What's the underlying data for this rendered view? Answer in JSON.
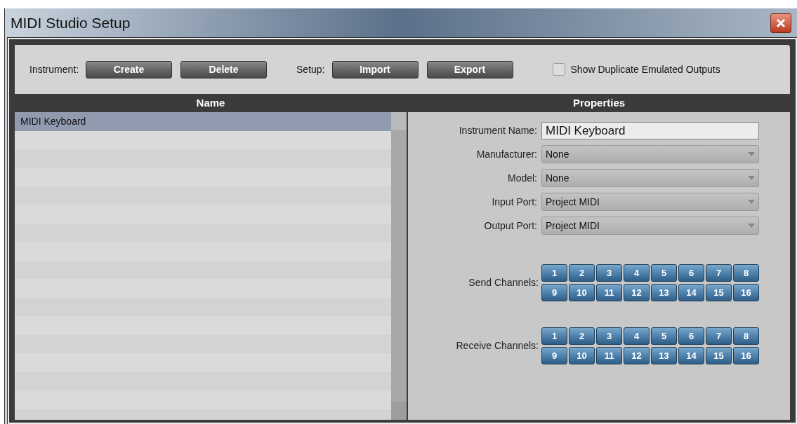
{
  "window": {
    "title": "MIDI Studio Setup"
  },
  "toolbar": {
    "instrument_label": "Instrument:",
    "instrument_buttons": [
      "Create",
      "Delete"
    ],
    "setup_label": "Setup:",
    "setup_buttons": [
      "Import",
      "Export"
    ],
    "show_duplicates": {
      "label": "Show Duplicate Emulated Outputs",
      "checked": false
    }
  },
  "list": {
    "header": "Name",
    "items": [
      {
        "name": "MIDI Keyboard",
        "selected": true
      }
    ]
  },
  "properties": {
    "header": "Properties",
    "fields": [
      {
        "label": "Instrument Name:",
        "kind": "text",
        "value": "MIDI Keyboard"
      },
      {
        "label": "Manufacturer:",
        "kind": "dropdown",
        "value": "None"
      },
      {
        "label": "Model:",
        "kind": "dropdown",
        "value": "None"
      },
      {
        "label": "Input Port:",
        "kind": "dropdown",
        "value": "Project MIDI"
      },
      {
        "label": "Output Port:",
        "kind": "dropdown",
        "value": "Project MIDI"
      }
    ],
    "channel_groups": [
      {
        "label": "Send Channels:",
        "channels": [
          {
            "label": "1",
            "on": true
          },
          {
            "label": "2",
            "on": true
          },
          {
            "label": "3",
            "on": true
          },
          {
            "label": "4",
            "on": true
          },
          {
            "label": "5",
            "on": true
          },
          {
            "label": "6",
            "on": true
          },
          {
            "label": "7",
            "on": true
          },
          {
            "label": "8",
            "on": true
          },
          {
            "label": "9",
            "on": true
          },
          {
            "label": "10",
            "on": true
          },
          {
            "label": "11",
            "on": true
          },
          {
            "label": "12",
            "on": true
          },
          {
            "label": "13",
            "on": true
          },
          {
            "label": "14",
            "on": true
          },
          {
            "label": "15",
            "on": true
          },
          {
            "label": "16",
            "on": true
          }
        ]
      },
      {
        "label": "Receive Channels:",
        "channels": [
          {
            "label": "1",
            "on": true
          },
          {
            "label": "2",
            "on": true
          },
          {
            "label": "3",
            "on": true
          },
          {
            "label": "4",
            "on": true
          },
          {
            "label": "5",
            "on": true
          },
          {
            "label": "6",
            "on": true
          },
          {
            "label": "7",
            "on": true
          },
          {
            "label": "8",
            "on": true
          },
          {
            "label": "9",
            "on": true
          },
          {
            "label": "10",
            "on": true
          },
          {
            "label": "11",
            "on": true
          },
          {
            "label": "12",
            "on": true
          },
          {
            "label": "13",
            "on": true
          },
          {
            "label": "14",
            "on": true
          },
          {
            "label": "15",
            "on": true
          },
          {
            "label": "16",
            "on": true
          }
        ]
      }
    ]
  }
}
